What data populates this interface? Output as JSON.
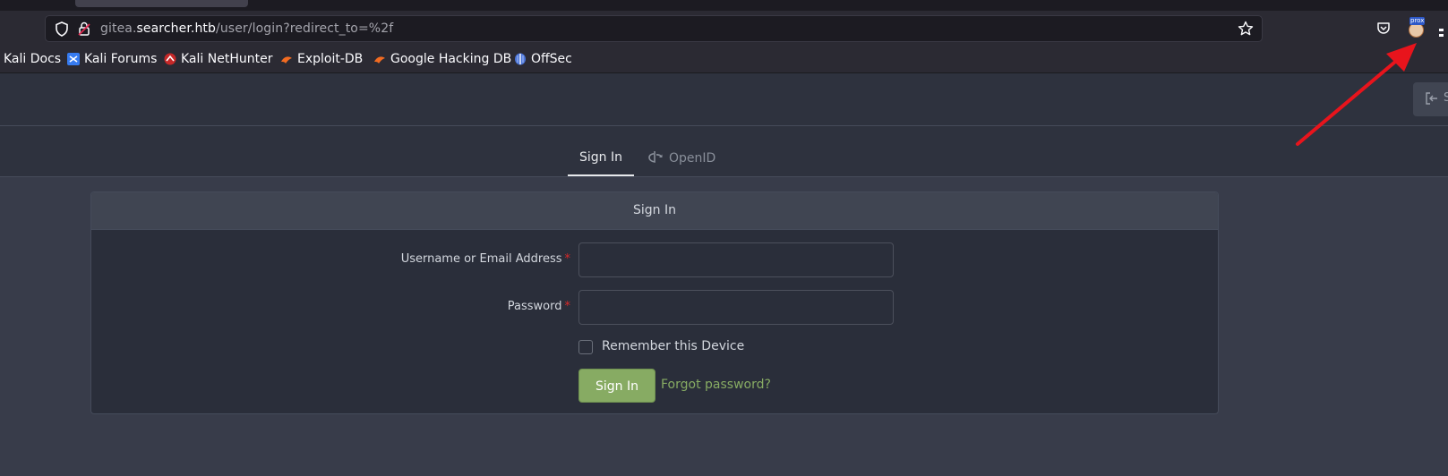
{
  "browser": {
    "url_domain_prefix": "gitea.",
    "url_domain": "searcher.htb",
    "url_path": "/user/login?redirect_to=%2f",
    "extension_tag": "prox"
  },
  "bookmarks": [
    {
      "label": "Kali Docs",
      "icon": "none"
    },
    {
      "label": "Kali Forums",
      "icon": "kali-forums-icon"
    },
    {
      "label": "Kali NetHunter",
      "icon": "nethunter-icon"
    },
    {
      "label": "Exploit-DB",
      "icon": "exploitdb-icon"
    },
    {
      "label": "Google Hacking DB",
      "icon": "ghdb-icon"
    },
    {
      "label": "OffSec",
      "icon": "offsec-icon"
    }
  ],
  "header": {
    "signin_partial": "S"
  },
  "tabs": [
    {
      "label": "Sign In",
      "active": true
    },
    {
      "label": "OpenID",
      "active": false
    }
  ],
  "form": {
    "title": "Sign In",
    "username_label": "Username or Email Address",
    "username_value": "",
    "password_label": "Password",
    "password_value": "",
    "required_marker": "*",
    "remember_label": "Remember this Device",
    "remember_checked": false,
    "submit_label": "Sign In",
    "forgot_label": "Forgot password?"
  },
  "colors": {
    "accent_green": "#87ab63",
    "annotation_arrow": "#e8141c",
    "page_bg": "#383c4a"
  }
}
